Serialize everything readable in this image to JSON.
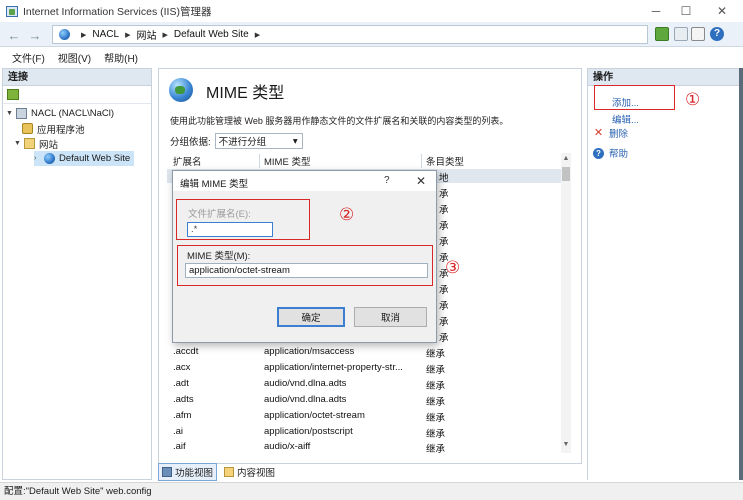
{
  "window": {
    "title": "Internet Information Services (IIS)管理器",
    "minimize": "─",
    "maximize": "☐",
    "close": "✕"
  },
  "address": {
    "crumbs": [
      "NACL",
      "网站",
      "Default Web Site"
    ],
    "separator": "▶"
  },
  "menu": [
    "文件(F)",
    "视图(V)",
    "帮助(H)"
  ],
  "connections": {
    "header": "连接",
    "tree": [
      {
        "label": "NACL (NACL\\NaCl)",
        "icon": "server-icon"
      },
      {
        "label": "应用程序池",
        "icon": "app-pool-icon"
      },
      {
        "label": "网站",
        "icon": "sites-folder-icon"
      },
      {
        "label": "Default Web Site",
        "icon": "globe-icon",
        "selected": true
      }
    ]
  },
  "main": {
    "title": "MIME 类型",
    "description": "使用此功能管理被 Web 服务器用作静态文件的文件扩展名和关联的内容类型的列表。",
    "group_by_label": "分组依据:",
    "group_by_value": "不进行分组",
    "columns": [
      "扩展名",
      "MIME 类型",
      "条目类型"
    ],
    "partial_entry_types": [
      "地",
      "承",
      "承",
      "承",
      "承",
      "承",
      "承",
      "承",
      "承",
      "承",
      "承",
      "承",
      "承",
      "承",
      "承",
      "承",
      "承",
      "承"
    ],
    "rows": [
      {
        "ext": ".accdt",
        "mime": "application/msaccess",
        "type": "继承"
      },
      {
        "ext": ".acx",
        "mime": "application/internet-property-str...",
        "type": "继承"
      },
      {
        "ext": ".adt",
        "mime": "audio/vnd.dlna.adts",
        "type": "继承"
      },
      {
        "ext": ".adts",
        "mime": "audio/vnd.dlna.adts",
        "type": "继承"
      },
      {
        "ext": ".afm",
        "mime": "application/octet-stream",
        "type": "继承"
      },
      {
        "ext": ".ai",
        "mime": "application/postscript",
        "type": "继承"
      },
      {
        "ext": ".aif",
        "mime": "audio/x-aiff",
        "type": "继承"
      }
    ],
    "tabs": [
      "功能视图",
      "内容视图"
    ]
  },
  "actions": {
    "header": "操作",
    "items": [
      {
        "label": "添加...",
        "icon": "add-icon"
      },
      {
        "label": "编辑...",
        "icon": "edit-icon"
      },
      {
        "label": "删除",
        "icon": "delete-icon"
      },
      {
        "label": "帮助",
        "icon": "help-icon"
      }
    ]
  },
  "dialog": {
    "title": "编辑 MIME 类型",
    "help": "?",
    "close": "✕",
    "ext_label": "文件扩展名(E):",
    "ext_value": ".*",
    "mime_label": "MIME 类型(M):",
    "mime_value": "application/octet-stream",
    "ok": "确定",
    "cancel": "取消"
  },
  "annotations": [
    "①",
    "②",
    "③"
  ],
  "status": "配置:\"Default Web Site\" web.config",
  "colors": {
    "annotation_red": "#d9282a",
    "link_blue": "#2a62b0",
    "header_bg": "#dfe8f1"
  }
}
